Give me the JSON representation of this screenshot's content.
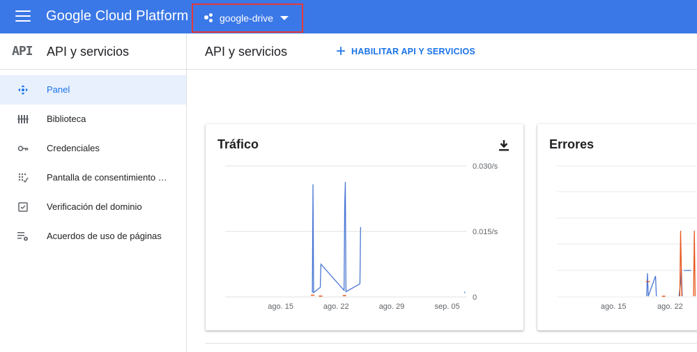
{
  "topbar": {
    "brand": "Google Cloud Platform",
    "project": "google-drive"
  },
  "sidebar": {
    "logo": "API",
    "title": "API y servicios",
    "items": [
      {
        "label": "Panel",
        "icon": "dashboard-icon",
        "active": true
      },
      {
        "label": "Biblioteca",
        "icon": "library-icon"
      },
      {
        "label": "Credenciales",
        "icon": "key-icon"
      },
      {
        "label": "Pantalla de consentimiento …",
        "icon": "consent-icon"
      },
      {
        "label": "Verificación del dominio",
        "icon": "domain-check-icon"
      },
      {
        "label": "Acuerdos de uso de páginas",
        "icon": "page-settings-icon"
      }
    ]
  },
  "main": {
    "title": "API y servicios",
    "enable_button": "HABILITAR API Y SERVICIOS"
  },
  "cards": {
    "traffic": {
      "title": "Tráfico"
    },
    "errors": {
      "title": "Errores"
    }
  },
  "colors": {
    "brand": "#3b78e7",
    "accent": "#1a73e8",
    "series_blue": "#4a77d4",
    "series_orange": "#e8571b"
  },
  "chart_data": [
    {
      "type": "line",
      "title": "Tráfico",
      "x_ticks": [
        "ago. 15",
        "ago. 22",
        "ago. 29",
        "sep. 05"
      ],
      "y_ticks": [
        "0.030/s",
        "0.015/s",
        "0"
      ],
      "ylim": [
        0,
        0.03
      ],
      "grid": true,
      "series": [
        {
          "color": "#4a77d4",
          "points": [
            [
              "ago. 19",
              0.001
            ],
            [
              "ago. 19",
              0.0258
            ],
            [
              "ago. 19",
              0.001
            ],
            [
              "ago. 20",
              0.0022
            ],
            [
              "ago. 20",
              0.0075
            ],
            [
              "ago. 23",
              0.0015
            ],
            [
              "ago. 23",
              0.021
            ],
            [
              "ago. 23",
              0.0263
            ],
            [
              "ago. 23",
              0.0012
            ],
            [
              "ago. 25",
              0.003
            ],
            [
              "ago. 25",
              0.016
            ]
          ]
        },
        {
          "color": "#e8571b",
          "points": [
            [
              "ago. 19",
              0.0004
            ],
            [
              "ago. 20",
              0.0002
            ],
            [
              "ago. 23",
              0.0003
            ]
          ]
        }
      ]
    },
    {
      "type": "line",
      "title": "Errores",
      "x_ticks": [
        "ago. 15",
        "ago. 22"
      ],
      "grid": true,
      "series": [
        {
          "color": "#4a77d4",
          "points": "spikes near ago. 19–ago. 24"
        },
        {
          "color": "#e8571b",
          "points": "spikes near ago. 23–ago. 25"
        }
      ]
    }
  ]
}
